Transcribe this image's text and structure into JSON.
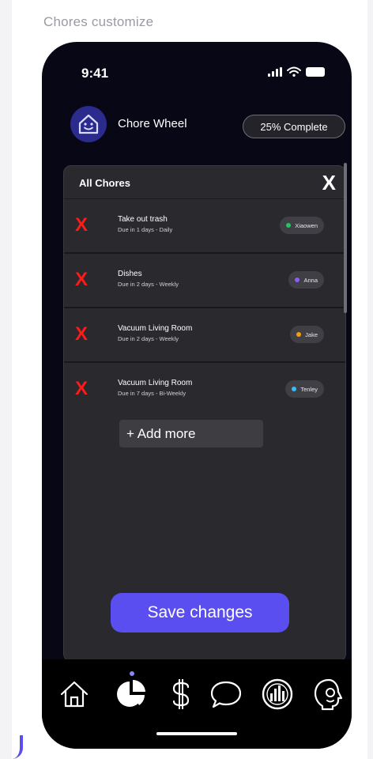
{
  "canvas": {
    "label": "Chores customize"
  },
  "status_bar": {
    "time": "9:41"
  },
  "header": {
    "app_title": "Chore Wheel",
    "progress_label": "25% Complete"
  },
  "card": {
    "title": "All Chores",
    "close_label": "X",
    "delete_label": "X",
    "chores": [
      {
        "name": "Take out trash",
        "due": "Due in 1 days - Daily",
        "assignee": "Xiaowen",
        "color": "#22c55e"
      },
      {
        "name": "Dishes",
        "due": "Due in 2 days - Weekly",
        "assignee": "Anna",
        "color": "#8b5cf6"
      },
      {
        "name": "Vacuum Living Room",
        "due": "Due in 2 days - Weekly",
        "assignee": "Jake",
        "color": "#f59e0b"
      },
      {
        "name": "Vacuum Living Room",
        "due": "Due in 7 days - Bi-Weekly",
        "assignee": "Tenley",
        "color": "#38bdf8"
      }
    ],
    "add_more_label": "+ Add more",
    "save_label": "Save changes"
  },
  "tab_bar": {
    "active": "chores-wheel",
    "icons": [
      "home-icon",
      "pie-chart-icon",
      "dollar-icon",
      "chat-icon",
      "stats-icon",
      "profile-icon"
    ]
  },
  "colors": {
    "accent": "#5b4ef0",
    "delete": "#ff1a1a",
    "background": "#070716",
    "card": "#29292e"
  }
}
